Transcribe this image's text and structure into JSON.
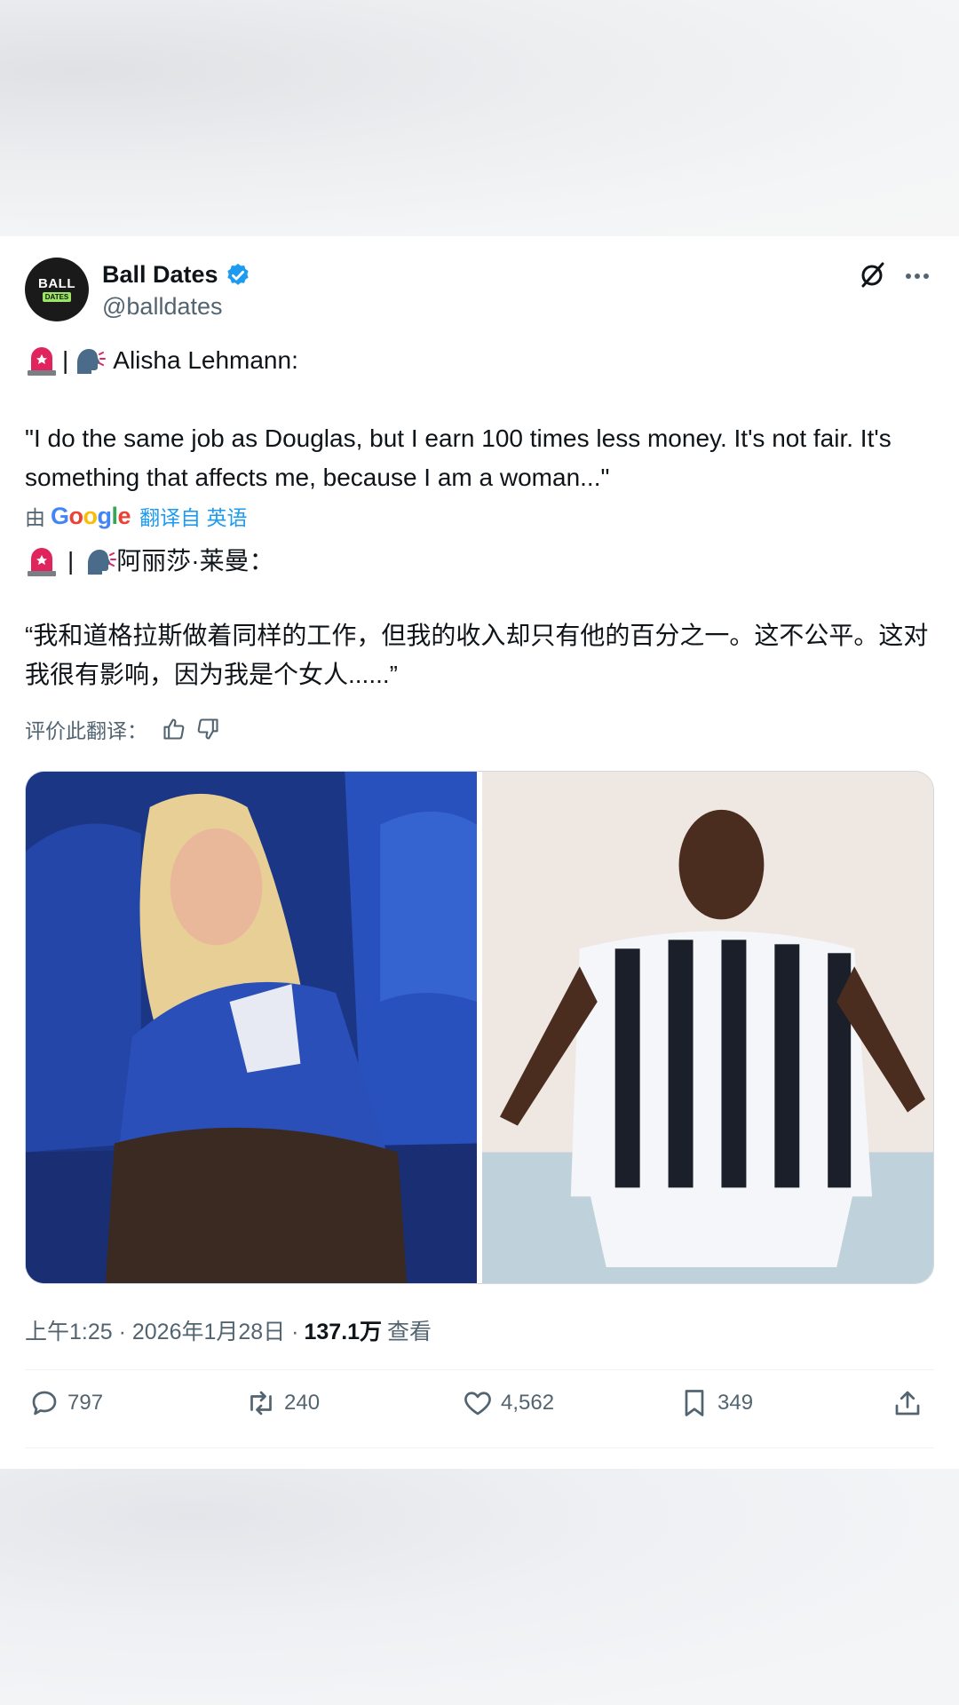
{
  "author": {
    "avatar_top": "BALL",
    "avatar_bottom": "DATES",
    "display_name": "Ball Dates",
    "handle": "@balldates"
  },
  "post": {
    "separator": "|",
    "speaker": "Alisha Lehmann:",
    "quote": "\"I do the same job as Douglas, but I earn 100 times less money. It's not fair. It's something that affects me, because I am a woman...\"",
    "translation": {
      "by_label": "由",
      "provider": "Google",
      "translated_from": "翻译自 英语",
      "speaker": "阿丽莎·莱曼：",
      "quote": "“我和道格拉斯做着同样的工作，但我的收入却只有他的百分之一。这不公平。这对我很有影响，因为我是个女人......”"
    },
    "rate_label": "评价此翻译：",
    "timestamp": "上午1:25 · 2026年1月28日 ·",
    "views_count": "137.1万",
    "views_label": "查看"
  },
  "actions": {
    "replies": "797",
    "reposts": "240",
    "likes": "4,562",
    "bookmarks": "349"
  },
  "images": [
    {
      "name": "alisha-lehmann-photo",
      "subject": "woman in blue jersey seated in stadium dugout"
    },
    {
      "name": "douglas-costa-photo",
      "subject": "footballer in black-and-white striped jersey"
    }
  ],
  "colors": {
    "accent": "#1d9bf0",
    "text": "#0f1419",
    "muted": "#536471",
    "siren": "#e0245e"
  },
  "icons": [
    "verified-badge-icon",
    "grok-icon",
    "more-icon",
    "siren-emoji-icon",
    "speaking-head-emoji-icon",
    "thumbs-up-icon",
    "thumbs-down-icon",
    "reply-icon",
    "repost-icon",
    "like-icon",
    "bookmark-icon",
    "share-icon"
  ]
}
